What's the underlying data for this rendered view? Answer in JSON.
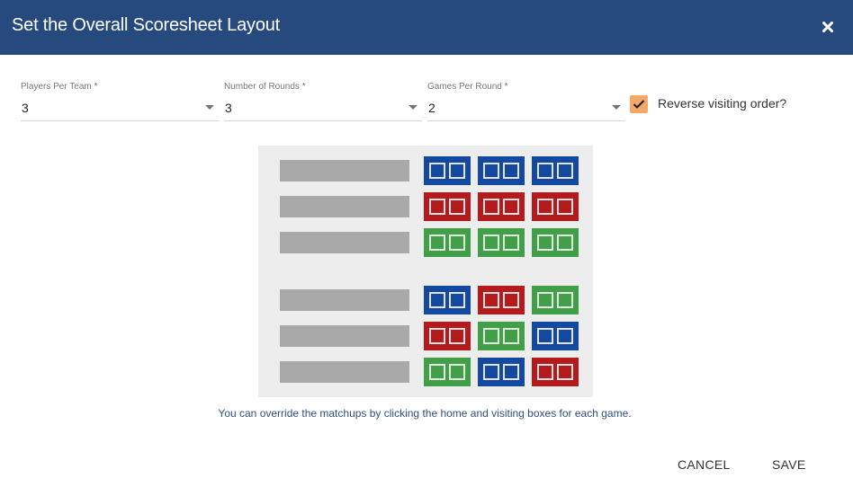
{
  "dialog": {
    "title": "Set the Overall Scoresheet Layout",
    "close_icon": "close-icon"
  },
  "fields": [
    {
      "label": "Players Per Team *",
      "value": "3"
    },
    {
      "label": "Number of Rounds *",
      "value": "3"
    },
    {
      "label": "Games Per Round *",
      "value": "2"
    }
  ],
  "reverse_visiting": {
    "label": "Reverse visiting order?",
    "checked": true
  },
  "colors": {
    "header": "#264a7e",
    "blue": "#1349a0",
    "red": "#b51a1d",
    "green": "#41a047",
    "checkbox": "#f4a868",
    "name_bar": "#a9a9a9",
    "panel": "#ededed"
  },
  "scoresheet": {
    "sections": [
      {
        "rows": [
          [
            "blue",
            "blue",
            "blue"
          ],
          [
            "red",
            "red",
            "red"
          ],
          [
            "green",
            "green",
            "green"
          ]
        ]
      },
      {
        "rows": [
          [
            "blue",
            "red",
            "green"
          ],
          [
            "red",
            "green",
            "blue"
          ],
          [
            "green",
            "blue",
            "red"
          ]
        ]
      }
    ]
  },
  "note": "You can override the matchups by clicking the home and visiting boxes for each game.",
  "actions": {
    "cancel_label": "CANCEL",
    "save_label": "SAVE"
  }
}
